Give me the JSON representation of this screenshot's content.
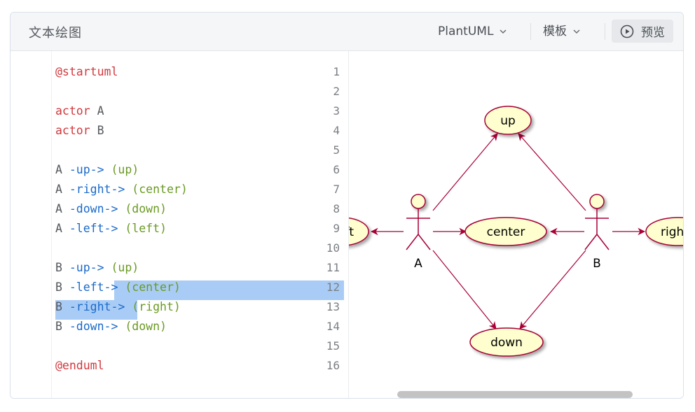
{
  "header": {
    "title": "文本绘图",
    "language_select": "PlantUML",
    "template_select": "模板",
    "preview_label": "预览"
  },
  "editor": {
    "line_numbers": [
      "1",
      "2",
      "3",
      "4",
      "5",
      "6",
      "7",
      "8",
      "9",
      "10",
      "11",
      "12",
      "13",
      "14",
      "15",
      "16"
    ],
    "lines": [
      [
        {
          "t": "@startuml",
          "c": "red"
        }
      ],
      [],
      [
        {
          "t": "actor",
          "c": "red"
        },
        {
          "t": " A",
          "c": "plain"
        }
      ],
      [
        {
          "t": "actor",
          "c": "red"
        },
        {
          "t": " B",
          "c": "plain"
        }
      ],
      [],
      [
        {
          "t": "A ",
          "c": "plain"
        },
        {
          "t": "-up->",
          "c": "blue"
        },
        {
          "t": " (up)",
          "c": "green"
        }
      ],
      [
        {
          "t": "A ",
          "c": "plain"
        },
        {
          "t": "-right->",
          "c": "blue"
        },
        {
          "t": " (center)",
          "c": "green"
        }
      ],
      [
        {
          "t": "A ",
          "c": "plain"
        },
        {
          "t": "-down->",
          "c": "blue"
        },
        {
          "t": " (down)",
          "c": "green"
        }
      ],
      [
        {
          "t": "A ",
          "c": "plain"
        },
        {
          "t": "-left->",
          "c": "blue"
        },
        {
          "t": " (left)",
          "c": "green"
        }
      ],
      [],
      [
        {
          "t": "B ",
          "c": "plain"
        },
        {
          "t": "-up->",
          "c": "blue"
        },
        {
          "t": " (up)",
          "c": "green"
        }
      ],
      [
        {
          "t": "B ",
          "c": "plain"
        },
        {
          "t": "-left->",
          "c": "blue"
        },
        {
          "t": " (center)",
          "c": "green"
        }
      ],
      [
        {
          "t": "B ",
          "c": "plain"
        },
        {
          "t": "-right->",
          "c": "blue"
        },
        {
          "t": " (right)",
          "c": "green"
        }
      ],
      [
        {
          "t": "B ",
          "c": "plain"
        },
        {
          "t": "-down->",
          "c": "blue"
        },
        {
          "t": " (down)",
          "c": "green"
        }
      ],
      [],
      [
        {
          "t": "@enduml",
          "c": "red"
        }
      ]
    ]
  },
  "diagram": {
    "actors": [
      "A",
      "B"
    ],
    "usecases": {
      "up": "up",
      "center": "center",
      "down": "down",
      "left": "ft",
      "right": "righ"
    }
  },
  "colors": {
    "usecase_fill": "#fefece",
    "stroke": "#a80036",
    "keyword_red": "#d1383d",
    "keyword_blue": "#1b6ac9",
    "string_green": "#6a9a23",
    "selection": "#a9ccf6"
  },
  "icons": {
    "language_chevron": "chevron-down-icon",
    "template_chevron": "chevron-down-icon",
    "preview": "play-circle-icon"
  }
}
